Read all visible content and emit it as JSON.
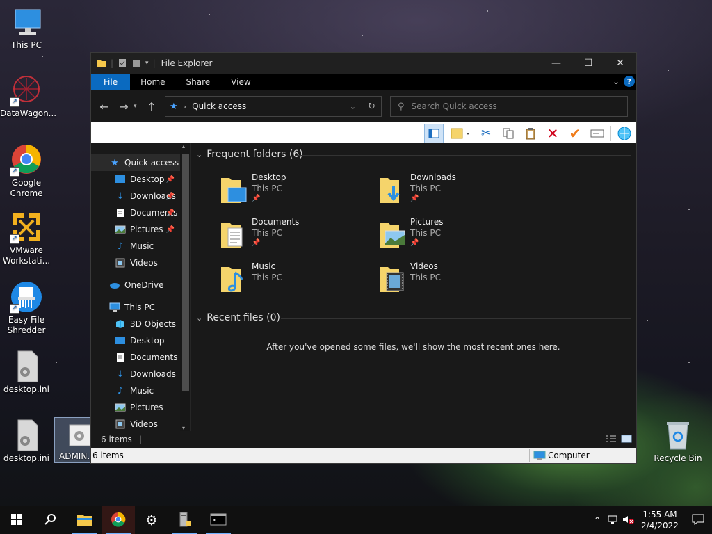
{
  "desktop": {
    "icons": [
      {
        "label": "This PC"
      },
      {
        "label": "DataWagon..."
      },
      {
        "label": "Google Chrome"
      },
      {
        "label": "VMware Workstati..."
      },
      {
        "label": "Easy File Shredder"
      },
      {
        "label": "desktop.ini"
      },
      {
        "label": "desktop.ini"
      },
      {
        "label": "ADMIN..."
      },
      {
        "label": "Recycle Bin"
      }
    ]
  },
  "window": {
    "title": "File Explorer",
    "ribbon_tabs": [
      "File",
      "Home",
      "Share",
      "View"
    ],
    "address": "Quick access",
    "search_placeholder": "Search Quick access",
    "nav": {
      "quick_access": "Quick access",
      "quick_items": [
        {
          "label": "Desktop",
          "pinned": true
        },
        {
          "label": "Downloads",
          "pinned": true
        },
        {
          "label": "Documents",
          "pinned": true
        },
        {
          "label": "Pictures",
          "pinned": true
        },
        {
          "label": "Music",
          "pinned": false
        },
        {
          "label": "Videos",
          "pinned": false
        }
      ],
      "onedrive": "OneDrive",
      "this_pc": "This PC",
      "pc_items": [
        "3D Objects",
        "Desktop",
        "Documents",
        "Downloads",
        "Music",
        "Pictures",
        "Videos"
      ]
    },
    "frequent_header": "Frequent folders (6)",
    "folders": [
      {
        "name": "Desktop",
        "location": "This PC"
      },
      {
        "name": "Downloads",
        "location": "This PC"
      },
      {
        "name": "Documents",
        "location": "This PC"
      },
      {
        "name": "Pictures",
        "location": "This PC"
      },
      {
        "name": "Music",
        "location": "This PC"
      },
      {
        "name": "Videos",
        "location": "This PC"
      }
    ],
    "recent_header": "Recent files (0)",
    "recent_empty": "After you've opened some files, we'll show the most recent ones here.",
    "status_items": "6 items",
    "status_bar_items": "6 items",
    "status_bar_location": "Computer"
  },
  "taskbar": {
    "time": "1:55 AM",
    "date": "2/4/2022"
  }
}
